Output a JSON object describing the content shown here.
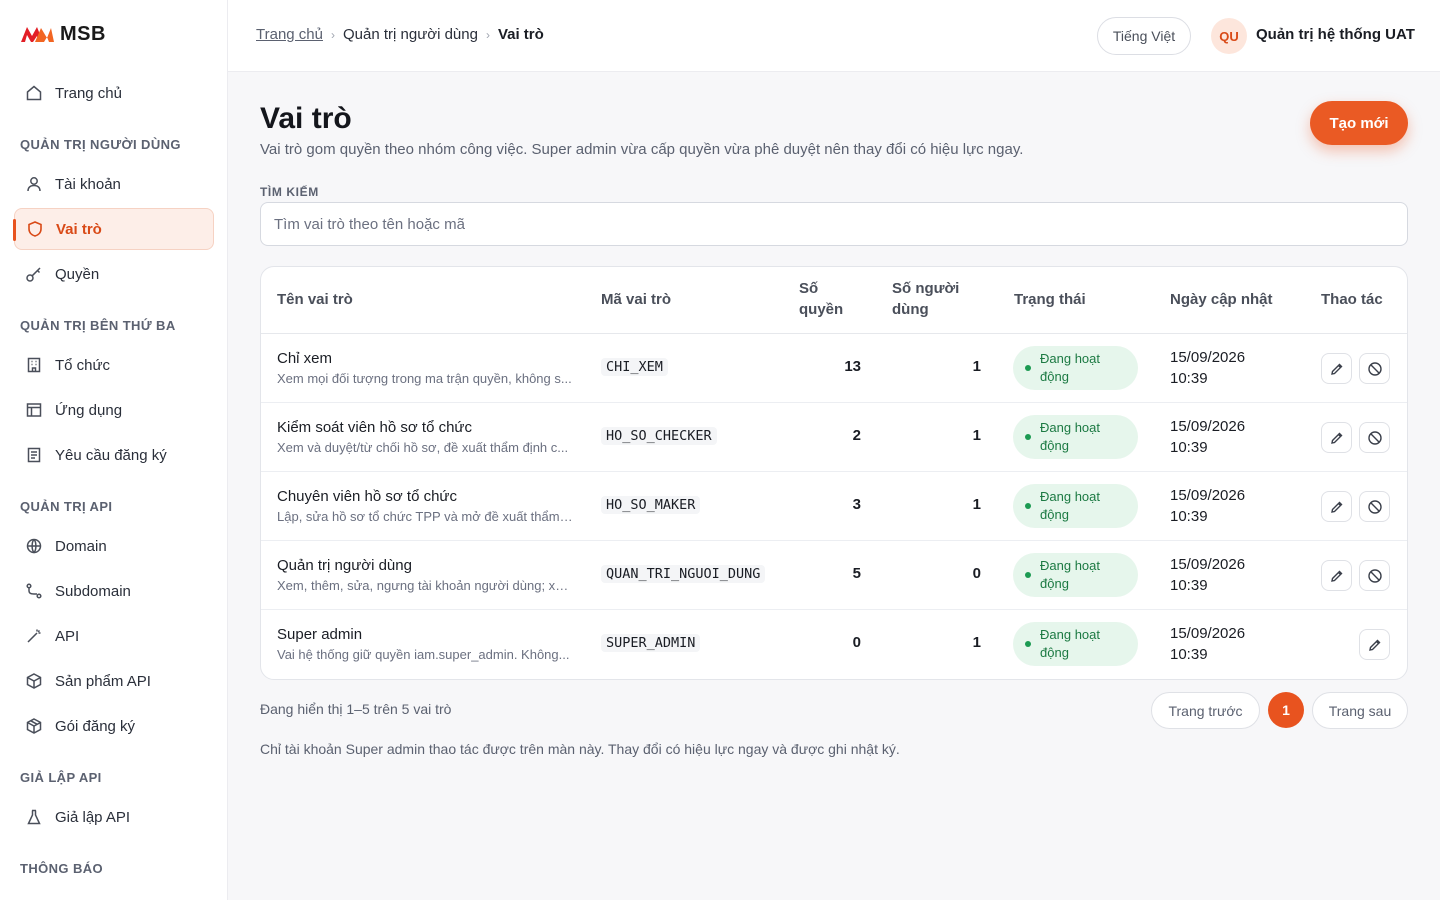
{
  "brand": {
    "name": "MSB",
    "accent": "#e8531f",
    "logo_colors": [
      "#e21e26",
      "#f26522"
    ]
  },
  "sidebar": {
    "home": "Trang chủ",
    "sections": [
      {
        "title": "QUẢN TRỊ NGƯỜI DÙNG",
        "items": [
          "Tài khoản",
          "Vai trò",
          "Quyền"
        ]
      },
      {
        "title": "QUẢN TRỊ BÊN THỨ BA",
        "items": [
          "Tổ chức",
          "Ứng dụng",
          "Yêu cầu đăng ký"
        ]
      },
      {
        "title": "QUẢN TRỊ API",
        "items": [
          "Domain",
          "Subdomain",
          "API",
          "Sản phẩm API",
          "Gói đăng ký"
        ]
      },
      {
        "title": "GIẢ LẬP API",
        "items": [
          "Giả lập API"
        ]
      },
      {
        "title": "THÔNG BÁO",
        "items": []
      }
    ],
    "active_item": "Vai trò"
  },
  "topbar": {
    "breadcrumb": [
      "Trang chủ",
      "Quản trị người dùng",
      "Vai trò"
    ],
    "language": "Tiếng Việt",
    "avatar_initials": "QU",
    "user_name": "Quản trị hệ thống UAT"
  },
  "page": {
    "title": "Vai trò",
    "description": "Vai trò gom quyền theo nhóm công việc. Super admin vừa cấp quyền vừa phê duyệt nên thay đổi có hiệu lực ngay.",
    "create_label": "Tạo mới",
    "search_label": "TÌM KIẾM",
    "search_placeholder": "Tìm vai trò theo tên hoặc mã",
    "search_value": ""
  },
  "table": {
    "headers": {
      "name": "Tên vai trò",
      "code": "Mã vai trò",
      "perm_line1": "Số",
      "perm_line2": "quyền",
      "users_line1": "Số người",
      "users_line2": "dùng",
      "status": "Trạng thái",
      "updated": "Ngày cập nhật",
      "actions": "Thao tác"
    },
    "rows": [
      {
        "name": "Chỉ xem",
        "desc": "Xem mọi đối tượng trong ma trận quyền, không s...",
        "code": "CHI_XEM",
        "permissions": "13",
        "users": "1",
        "status_line1": "Đang hoạt",
        "status_line2": "động",
        "date": "15/09/2026",
        "time": "10:39",
        "can_disable": true
      },
      {
        "name": "Kiểm soát viên hồ sơ tổ chức",
        "desc": "Xem và duyệt/từ chối hồ sơ, đề xuất thẩm định c...",
        "code": "HO_SO_CHECKER",
        "permissions": "2",
        "users": "1",
        "status_line1": "Đang hoạt",
        "status_line2": "động",
        "date": "15/09/2026",
        "time": "10:39",
        "can_disable": true
      },
      {
        "name": "Chuyên viên hồ sơ tổ chức",
        "desc": "Lập, sửa hồ sơ tổ chức TPP và mở đề xuất thẩm ...",
        "code": "HO_SO_MAKER",
        "permissions": "3",
        "users": "1",
        "status_line1": "Đang hoạt",
        "status_line2": "động",
        "date": "15/09/2026",
        "time": "10:39",
        "can_disable": true
      },
      {
        "name": "Quản trị người dùng",
        "desc": "Xem, thêm, sửa, ngưng tài khoản người dùng; xe...",
        "code": "QUAN_TRI_NGUOI_DUNG",
        "permissions": "5",
        "users": "0",
        "status_line1": "Đang hoạt",
        "status_line2": "động",
        "date": "15/09/2026",
        "time": "10:39",
        "can_disable": true
      },
      {
        "name": "Super admin",
        "desc": "Vai hệ thống giữ quyền iam.super_admin. Không...",
        "code": "SUPER_ADMIN",
        "permissions": "0",
        "users": "1",
        "status_line1": "Đang hoạt",
        "status_line2": "động",
        "date": "15/09/2026",
        "time": "10:39",
        "can_disable": false
      }
    ]
  },
  "pagination": {
    "info": "Đang hiển thị 1–5 trên 5 vai trò",
    "prev": "Trang trước",
    "current": "1",
    "next": "Trang sau"
  },
  "note": "Chỉ tài khoản Super admin thao tác được trên màn này. Thay đổi có hiệu lực ngay và được ghi nhật ký."
}
